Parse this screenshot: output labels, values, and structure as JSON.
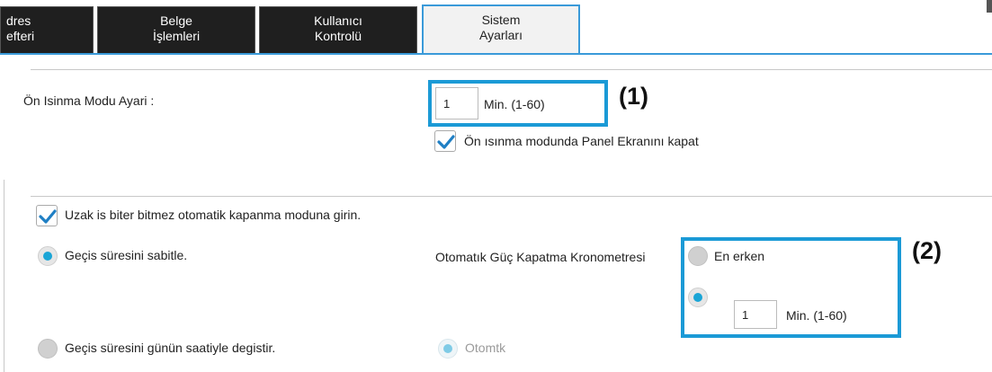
{
  "tabs": [
    {
      "line1": "dres",
      "line2": "efteri",
      "active": false
    },
    {
      "line1": "Belge",
      "line2": "İşlemleri",
      "active": false
    },
    {
      "line1": "Kullanıcı",
      "line2": "Kontrolü",
      "active": false
    },
    {
      "line1": "Sistem",
      "line2": "Ayarları",
      "active": true
    }
  ],
  "preheat": {
    "label": "Ön Isinma Modu Ayari :",
    "value": "1",
    "unit": "Min. (1-60)",
    "callout": "(1)",
    "panel_off_checkbox": {
      "label": "Ön ısınma modunda Panel Ekranını kapat",
      "checked": true
    }
  },
  "auto_power_off": {
    "enter_checkbox": {
      "label": "Uzak is biter bitmez otomatik kapanma moduna girin.",
      "checked": true
    },
    "fixed_radio": {
      "label": "Geçis süresini sabitle.",
      "selected": true
    },
    "timer_label": "Otomatık Güç Kapatma Kronometresi",
    "earliest_radio": {
      "label": "En erken",
      "selected": false
    },
    "custom_radio": {
      "selected": true
    },
    "value": "1",
    "unit": "Min. (1-60)",
    "callout": "(2)",
    "time_of_day_radio": {
      "label": "Geçis süresini günün saatiyle degistir.",
      "selected": false
    },
    "auto_radio": {
      "label": "Otomtk",
      "selected": true
    }
  }
}
